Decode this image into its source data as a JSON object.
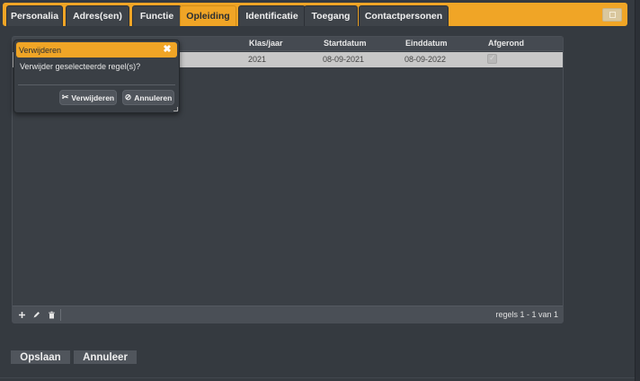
{
  "tabs": [
    {
      "label": "Personalia",
      "active": false
    },
    {
      "label": "Adres(sen)",
      "active": false
    },
    {
      "label": "Functie",
      "active": false
    },
    {
      "label": "Opleiding",
      "active": true
    },
    {
      "label": "Identificatie",
      "active": false
    },
    {
      "label": "Toegang",
      "active": false
    },
    {
      "label": "Contactpersonen",
      "active": false
    }
  ],
  "grid": {
    "columns": [
      "Klas/jaar",
      "Startdatum",
      "Einddatum",
      "Afgerond"
    ],
    "rows": [
      {
        "klas_jaar": "2021",
        "startdatum": "08-09-2021",
        "einddatum": "08-09-2022",
        "afgerond": true
      }
    ],
    "footer": {
      "add_icon": "plus-icon",
      "edit_icon": "pencil-icon",
      "delete_icon": "trash-icon",
      "record_info": "regels 1 - 1 van 1"
    }
  },
  "dialog": {
    "title": "Verwijderen",
    "message": "Verwijder geselecteerde regel(s)?",
    "confirm_label": "Verwijderen",
    "cancel_label": "Annuleren",
    "close_icon": "close-icon"
  },
  "actions": {
    "save_label": "Opslaan",
    "cancel_label": "Annuleer"
  },
  "colors": {
    "accent": "#f0a526",
    "background": "#353a40",
    "panel": "#3a3f45",
    "selected_row": "#c8c8c8"
  }
}
